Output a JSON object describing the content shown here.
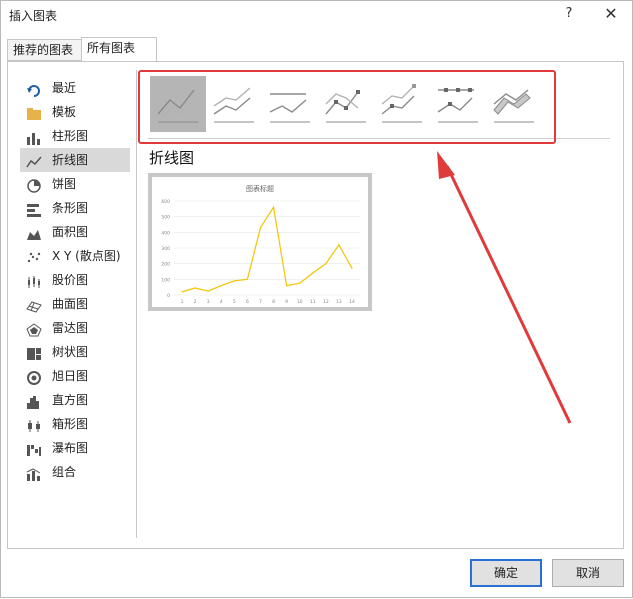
{
  "window": {
    "title": "插入图表",
    "help": "?",
    "close": "✕"
  },
  "tabs": [
    {
      "label": "推荐的图表"
    },
    {
      "label": "所有图表"
    }
  ],
  "sidebar": {
    "items": [
      {
        "label": "最近",
        "icon": "recent-icon"
      },
      {
        "label": "模板",
        "icon": "folder-icon"
      },
      {
        "label": "柱形图",
        "icon": "column-chart-icon"
      },
      {
        "label": "折线图",
        "icon": "line-chart-icon"
      },
      {
        "label": "饼图",
        "icon": "pie-chart-icon"
      },
      {
        "label": "条形图",
        "icon": "bar-chart-icon"
      },
      {
        "label": "面积图",
        "icon": "area-chart-icon"
      },
      {
        "label": "X Y (散点图)",
        "icon": "scatter-chart-icon"
      },
      {
        "label": "股价图",
        "icon": "stock-chart-icon"
      },
      {
        "label": "曲面图",
        "icon": "surface-chart-icon"
      },
      {
        "label": "雷达图",
        "icon": "radar-chart-icon"
      },
      {
        "label": "树状图",
        "icon": "treemap-chart-icon"
      },
      {
        "label": "旭日图",
        "icon": "sunburst-chart-icon"
      },
      {
        "label": "直方图",
        "icon": "histogram-chart-icon"
      },
      {
        "label": "箱形图",
        "icon": "boxplot-chart-icon"
      },
      {
        "label": "瀑布图",
        "icon": "waterfall-chart-icon"
      },
      {
        "label": "组合",
        "icon": "combo-chart-icon"
      }
    ],
    "selected": "折线图"
  },
  "chart_types": [
    {
      "icon": "line-icon",
      "selected": true
    },
    {
      "icon": "stacked-line-icon"
    },
    {
      "icon": "percent-stacked-line-icon"
    },
    {
      "icon": "line-with-markers-icon"
    },
    {
      "icon": "stacked-line-with-markers-icon"
    },
    {
      "icon": "percent-stacked-line-with-markers-icon"
    },
    {
      "icon": "3d-line-icon"
    }
  ],
  "subtype_title": "折线图",
  "buttons": {
    "ok": "确定",
    "cancel": "取消"
  },
  "colors": {
    "highlight": "#e03a3a",
    "series": "#f2c811",
    "selected_bg": "#b5b5b5"
  },
  "chart_data": {
    "type": "line",
    "title": "图表标题",
    "x": [
      1,
      2,
      3,
      4,
      5,
      6,
      7,
      8,
      9,
      10,
      11,
      12,
      13,
      14
    ],
    "series": [
      {
        "values": [
          20,
          45,
          25,
          60,
          90,
          100,
          430,
          560,
          60,
          75,
          140,
          200,
          320,
          170
        ]
      }
    ],
    "ylim": [
      0,
      600
    ],
    "yticks": [
      0,
      100,
      200,
      300,
      400,
      500,
      600
    ],
    "grid": true
  }
}
